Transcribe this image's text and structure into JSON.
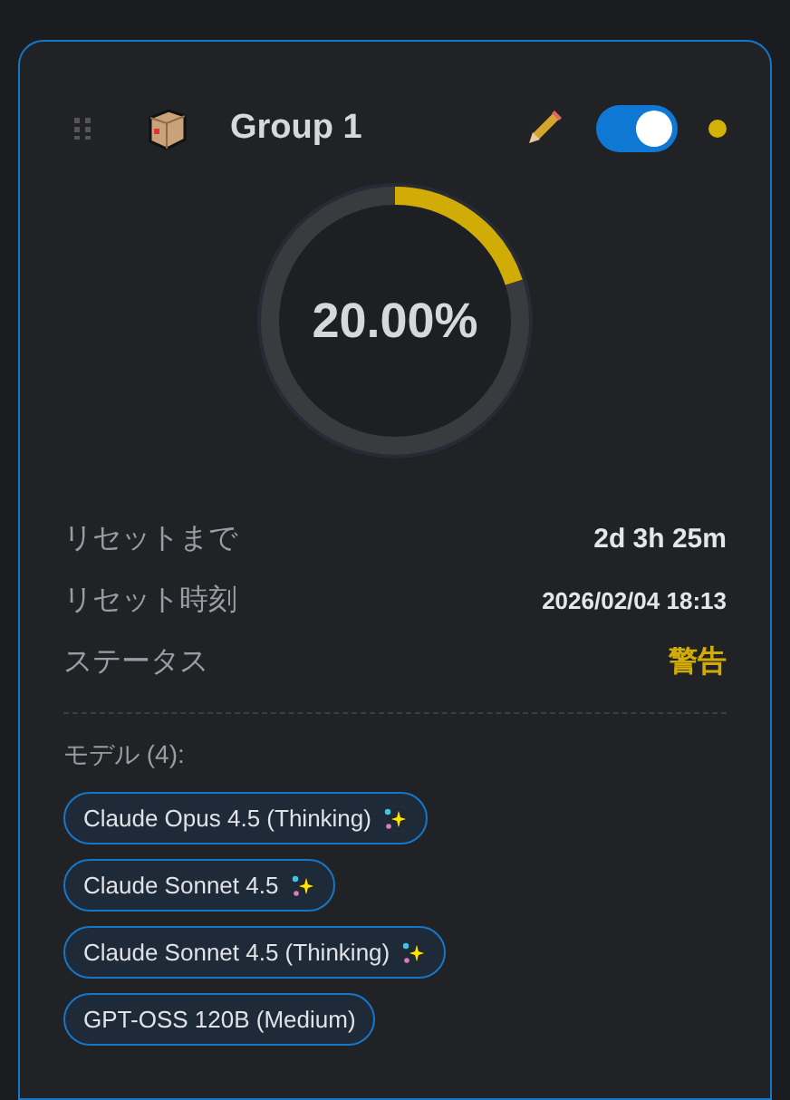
{
  "group": {
    "title": "Group 1",
    "enabled": true,
    "color": "#d4b106"
  },
  "usage": {
    "level": 0.2,
    "percent": "20.00%"
  },
  "details": [
    {
      "label": "リセットまで",
      "value": "2d 3h 25m",
      "kind": "normal"
    },
    {
      "label": "リセット時刻",
      "value": "2026/02/04 18:13",
      "kind": "small"
    },
    {
      "label": "ステータス",
      "value": "警告",
      "kind": "warning"
    }
  ],
  "models_label": "モデル (4):",
  "models": [
    {
      "name": "Claude Opus 4.5 (Thinking)",
      "sparkle": true
    },
    {
      "name": "Claude Sonnet 4.5",
      "sparkle": true
    },
    {
      "name": "Claude Sonnet 4.5 (Thinking)",
      "sparkle": true
    },
    {
      "name": "GPT-OSS 120B (Medium)",
      "sparkle": false
    }
  ]
}
